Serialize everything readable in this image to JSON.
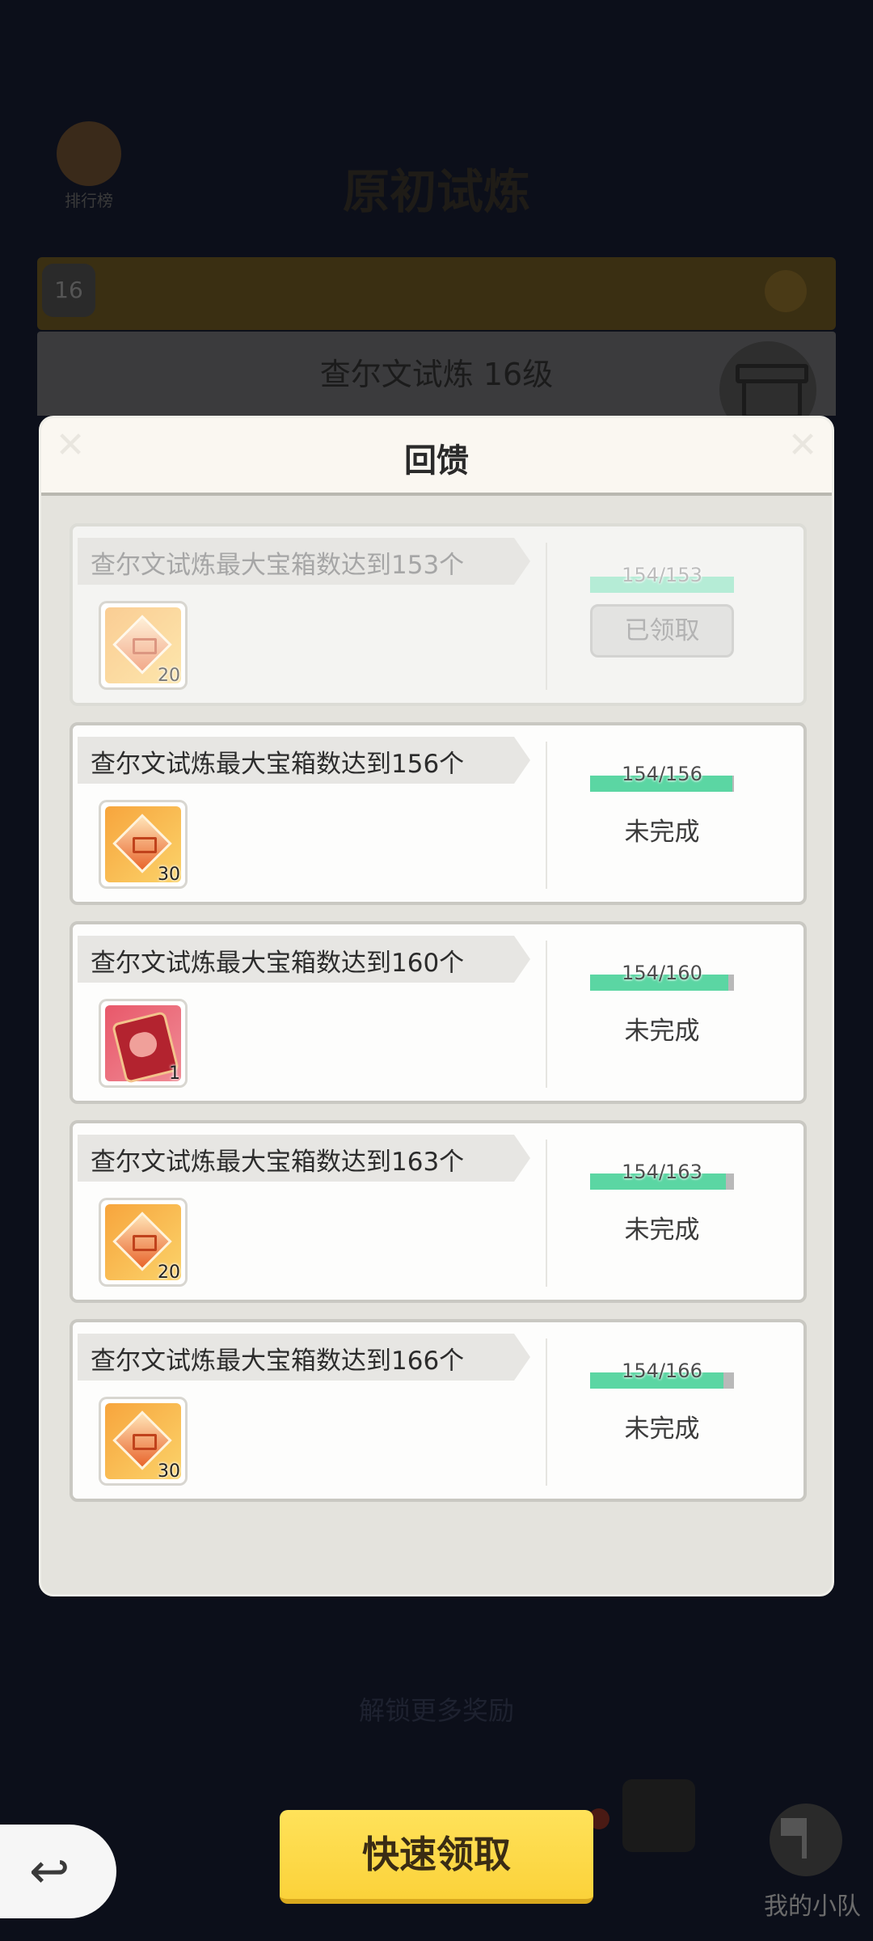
{
  "background": {
    "trophy_label": "排行榜",
    "trophy_sub": "",
    "title": "原初试炼",
    "level_badge": "16",
    "faint_text": "解锁更多奖励"
  },
  "subheader": {
    "title": "查尔文试炼 16级"
  },
  "dialog": {
    "title": "回馈",
    "close_glyph": "✕",
    "tasks": [
      {
        "text": "查尔文试炼最大宝箱数达到153个",
        "qty": "20",
        "progress_text": "154/153",
        "progress": 1.0,
        "status": "已领取",
        "item": "gem-icon",
        "claimed": true
      },
      {
        "text": "查尔文试炼最大宝箱数达到156个",
        "qty": "30",
        "progress_text": "154/156",
        "progress": 0.987,
        "status": "未完成",
        "item": "gem-icon",
        "claimed": false
      },
      {
        "text": "查尔文试炼最大宝箱数达到160个",
        "qty": "1",
        "progress_text": "154/160",
        "progress": 0.9625,
        "status": "未完成",
        "item": "card-icon",
        "claimed": false
      },
      {
        "text": "查尔文试炼最大宝箱数达到163个",
        "qty": "20",
        "progress_text": "154/163",
        "progress": 0.945,
        "status": "未完成",
        "item": "gem-icon",
        "claimed": false
      },
      {
        "text": "查尔文试炼最大宝箱数达到166个",
        "qty": "30",
        "progress_text": "154/166",
        "progress": 0.928,
        "status": "未完成",
        "item": "gem-icon",
        "claimed": false
      }
    ]
  },
  "bottom": {
    "back_glyph": "↩",
    "claim_label": "快速领取",
    "team_label": "我的小队"
  },
  "colors": {
    "accent": "#fbd23a",
    "progress": "#5bd6a3",
    "progress_done": "#b5ecd6"
  }
}
